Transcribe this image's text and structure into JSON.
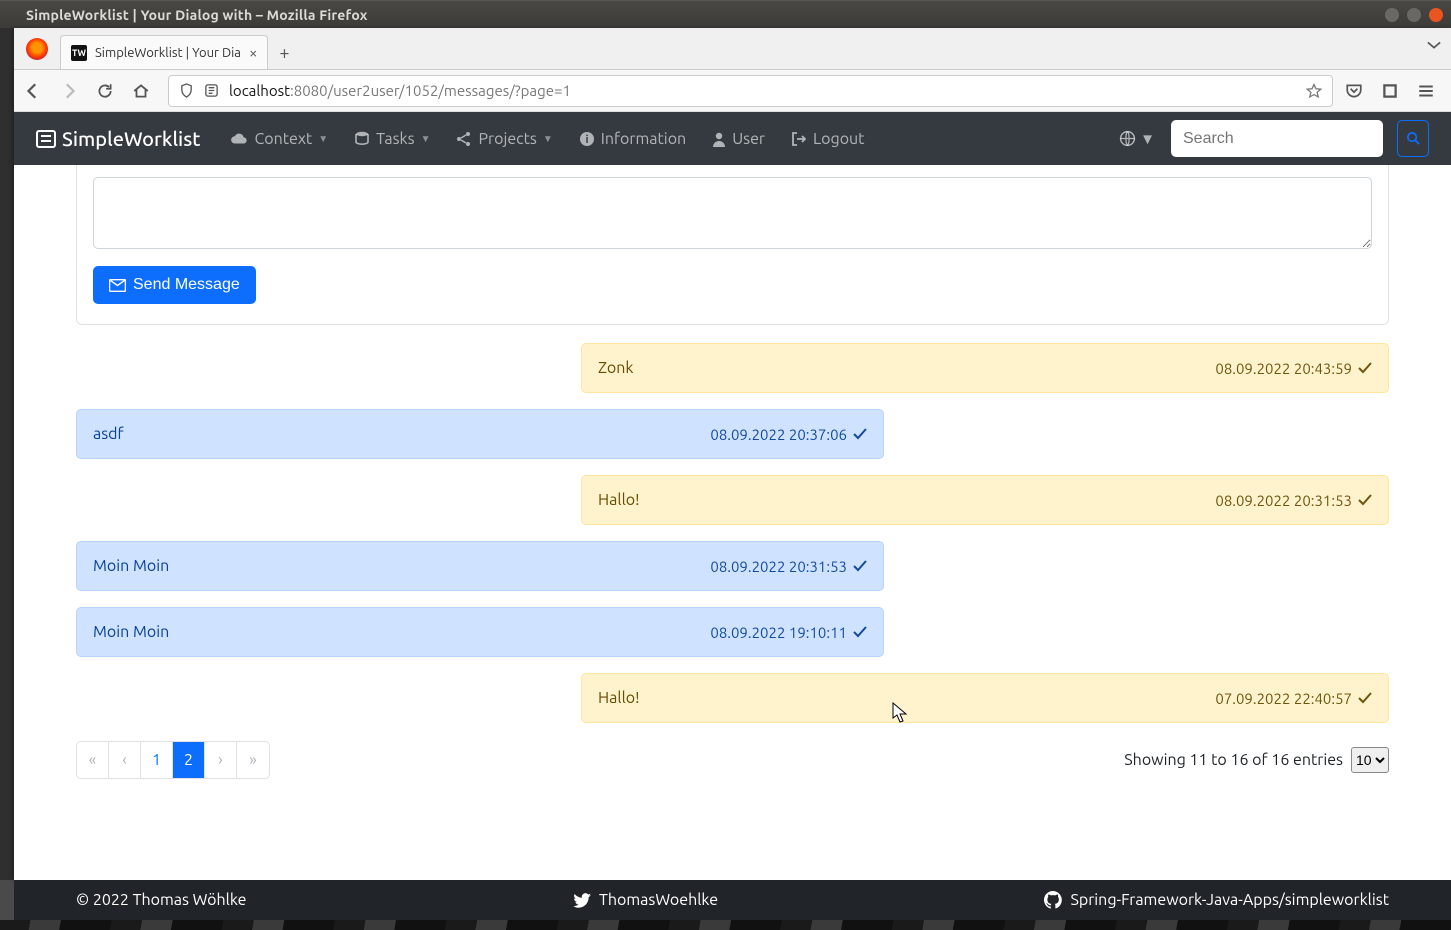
{
  "window": {
    "title": "SimpleWorklist | Your Dialog with – Mozilla Firefox"
  },
  "tab": {
    "favicon": "TW",
    "title": "SimpleWorklist | Your Dia"
  },
  "addressbar": {
    "host": "localhost",
    "rest": ":8080/user2user/1052/messages/?page=1"
  },
  "nav": {
    "brand": "SimpleWorklist",
    "context": "Context",
    "tasks": "Tasks",
    "projects": "Projects",
    "information": "Information",
    "user": "User",
    "logout": "Logout",
    "search_placeholder": "Search"
  },
  "compose": {
    "send_label": "Send Message"
  },
  "messages": [
    {
      "side": "sent",
      "text": "Zonk",
      "ts": "08.09.2022 20:43:59"
    },
    {
      "side": "recv",
      "text": "asdf",
      "ts": "08.09.2022 20:37:06"
    },
    {
      "side": "sent",
      "text": "Hallo!",
      "ts": "08.09.2022 20:31:53"
    },
    {
      "side": "recv",
      "text": "Moin Moin",
      "ts": "08.09.2022 20:31:53"
    },
    {
      "side": "recv",
      "text": "Moin Moin",
      "ts": "08.09.2022 19:10:11"
    },
    {
      "side": "sent",
      "text": "Hallo!",
      "ts": "07.09.2022 22:40:57"
    }
  ],
  "pagination": {
    "first": "«",
    "prev": "‹",
    "pages": [
      "1",
      "2"
    ],
    "active": "2",
    "next": "›",
    "last": "»",
    "summary": "Showing 11 to 16 of 16 entries",
    "page_size": "10"
  },
  "footer": {
    "copyright": "© 2022 Thomas Wöhlke",
    "twitter": "ThomasWoehlke",
    "github": "Spring-Framework-Java-Apps/simpleworklist"
  }
}
